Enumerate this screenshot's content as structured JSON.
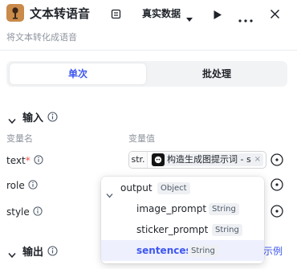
{
  "header": {
    "title": "文本转语音",
    "env_label": "真实数据",
    "description": "将文本转化成语音",
    "icons": [
      "app-icon",
      "doc-icon",
      "chevron-down-icon",
      "play-icon",
      "more-icon",
      "close-icon"
    ]
  },
  "tabs": [
    {
      "label": "单次",
      "active": true
    },
    {
      "label": "批处理",
      "active": false
    }
  ],
  "inputs": {
    "section_title": "输入",
    "col_name": "变量名",
    "col_value": "变量值",
    "rows": [
      {
        "name": "text",
        "required_mark": "*",
        "type_tag": "str.",
        "value": "构造生成图提示词 - s"
      },
      {
        "name": "role",
        "required_mark": ""
      },
      {
        "name": "style",
        "required_mark": ""
      }
    ]
  },
  "outputs": {
    "section_title": "输出",
    "sample_link": "示例"
  },
  "popup": {
    "root": {
      "name": "output",
      "type": "Object"
    },
    "children": [
      {
        "name": "image_prompt",
        "type": "String",
        "selected": false
      },
      {
        "name": "sticker_prompt",
        "type": "String",
        "selected": false
      },
      {
        "name": "sentences",
        "type": "String",
        "selected": true
      }
    ]
  },
  "colors": {
    "accent": "#3d56f0",
    "required": "#f54a45",
    "muted_text": "#8f959e",
    "selected_row_bg": "#eef0fe"
  }
}
